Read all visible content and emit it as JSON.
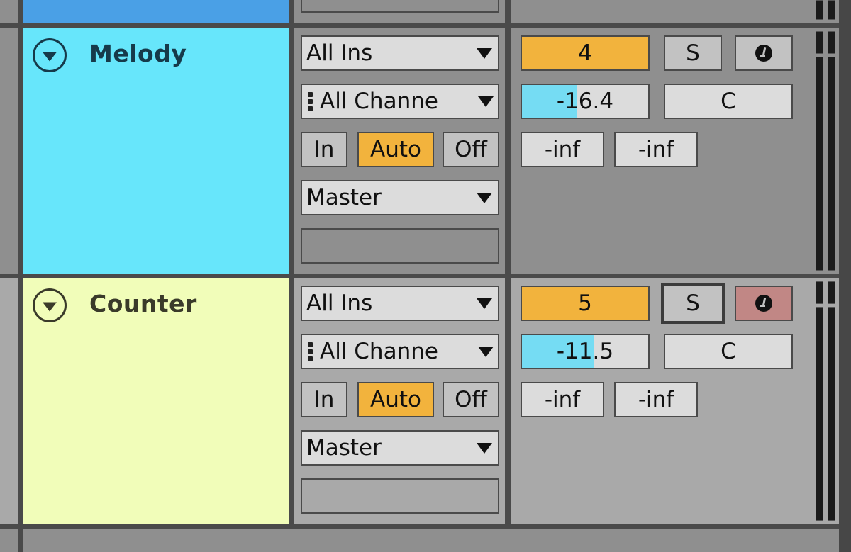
{
  "tracks": [
    {
      "name": "Melody",
      "color": "#67e6fb",
      "text_color": "#163a4a",
      "input_type": "All Ins",
      "input_channel": "All Channels",
      "input_channel_display": "All Channe",
      "monitor": {
        "options": [
          "In",
          "Auto",
          "Off"
        ],
        "active": "Auto"
      },
      "output": "Master",
      "track_number": "4",
      "solo_label": "S",
      "solo_selected": false,
      "arm_active": false,
      "volume": "-16.4",
      "volume_fill_fraction": 0.44,
      "pan": "C",
      "send_a": "-inf",
      "send_b": "-inf"
    },
    {
      "name": "Counter",
      "color": "#f1fdb9",
      "text_color": "#3a3a2a",
      "input_type": "All Ins",
      "input_channel": "All Channels",
      "input_channel_display": "All Channe",
      "monitor": {
        "options": [
          "In",
          "Auto",
          "Off"
        ],
        "active": "Auto"
      },
      "output": "Master",
      "track_number": "5",
      "solo_label": "S",
      "solo_selected": true,
      "arm_active": true,
      "volume": "-11.5",
      "volume_fill_fraction": 0.57,
      "pan": "C",
      "send_a": "-inf",
      "send_b": "-inf"
    }
  ],
  "colors": {
    "panel_dark": "#8f8f8f",
    "panel_light": "#a9a9a9",
    "accent_orange": "#f2b33d",
    "volume_fill": "#75dcf3",
    "arm_active": "#c18785",
    "top_track_color": "#4aa0e6"
  }
}
